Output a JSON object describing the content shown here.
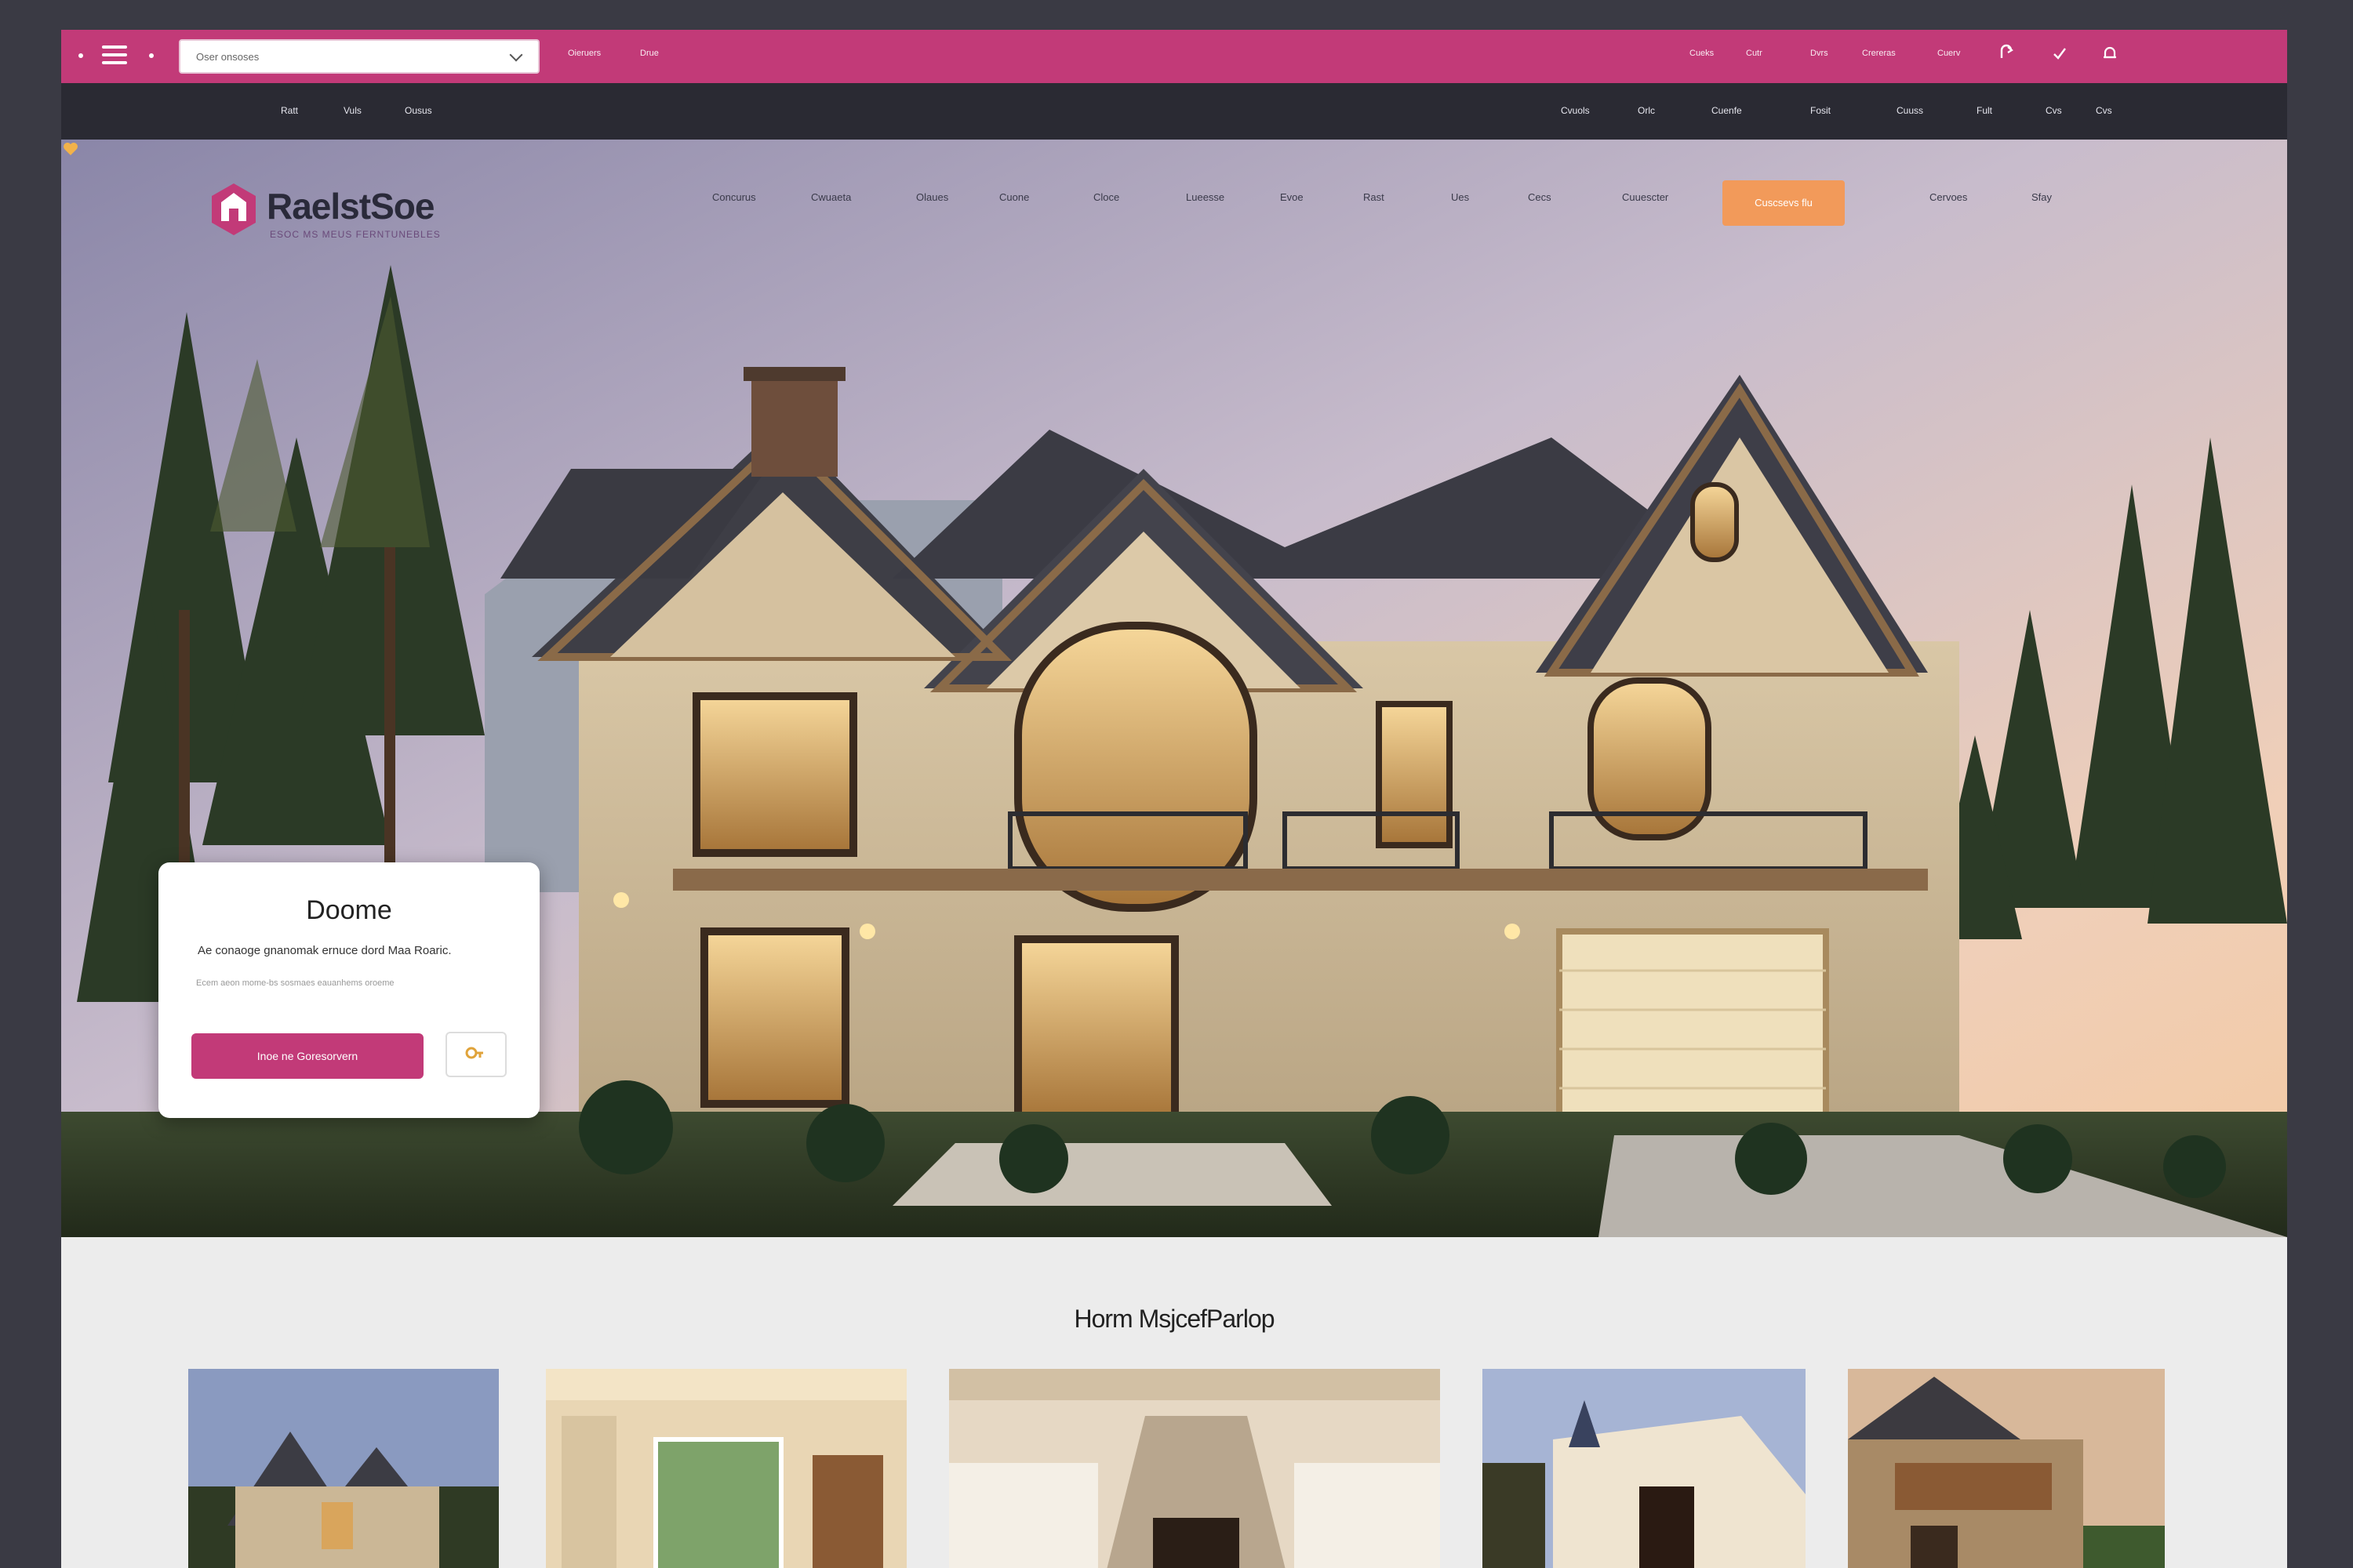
{
  "topbar": {
    "select_value": "Oser onsoses",
    "links": [
      "Oieruers",
      "Drue"
    ],
    "right_links": [
      "Cueks",
      "Cutr",
      "Dvrs",
      "Crereras",
      "Cuerv"
    ]
  },
  "darknav": {
    "left_items": [
      "Ratt",
      "Vuls",
      "Ousus"
    ],
    "right_items": [
      "Cvuols",
      "Orlc",
      "Cuenfe",
      "Fosit",
      "Cuuss",
      "Fult",
      "Cvs"
    ]
  },
  "brand": {
    "name": "RaelstSoe",
    "tagline": "ESOC MS MEUS FERNTUNEBLES"
  },
  "nav": {
    "items": [
      "Concurus",
      "Cwuaeta",
      "Olaues",
      "Cuone",
      "Cloce",
      "Lueesse",
      "Evoe",
      "Rast",
      "Ues",
      "Cecs",
      "Cuuescter"
    ],
    "cta": "Cuscsevs flu",
    "extra": [
      "Cervoes",
      "Sfay"
    ]
  },
  "card": {
    "title": "Doome",
    "subtitle": "Ae conaoge gnanomak ernuce dord Maa Roaric.",
    "fine_print": "Ecem aeon mome-bs sosmaes eauanhems oroeme",
    "primary_button": "Inoe ne Goresorvern",
    "secondary_icon": "key-icon"
  },
  "section": {
    "title": "Horm MsjcefParlop"
  },
  "colors": {
    "brand_pink": "#c23a78",
    "dark_nav": "#2a2a33",
    "cta_orange": "#f29a5a"
  }
}
